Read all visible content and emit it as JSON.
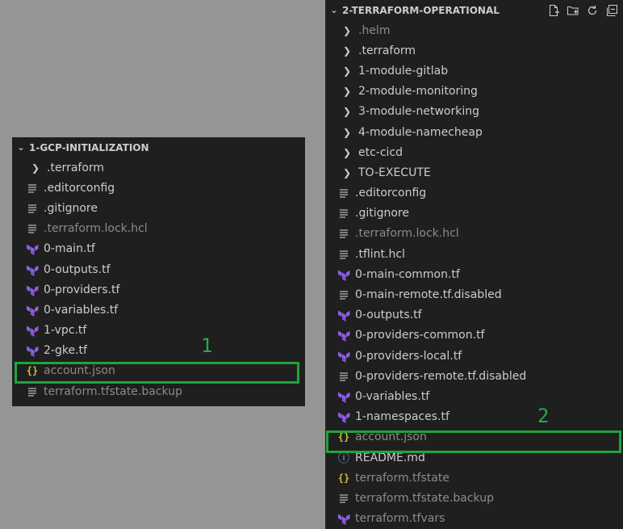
{
  "left_panel": {
    "title": "1-GCP-INITIALIZATION",
    "items": [
      {
        "label": ".terraform",
        "type": "folder",
        "dim": false
      },
      {
        "label": ".editorconfig",
        "type": "file",
        "dim": false
      },
      {
        "label": ".gitignore",
        "type": "file",
        "dim": false
      },
      {
        "label": ".terraform.lock.hcl",
        "type": "file",
        "dim": true
      },
      {
        "label": "0-main.tf",
        "type": "terraform",
        "dim": false
      },
      {
        "label": "0-outputs.tf",
        "type": "terraform",
        "dim": false
      },
      {
        "label": "0-providers.tf",
        "type": "terraform",
        "dim": false
      },
      {
        "label": "0-variables.tf",
        "type": "terraform",
        "dim": false
      },
      {
        "label": "1-vpc.tf",
        "type": "terraform",
        "dim": false
      },
      {
        "label": "2-gke.tf",
        "type": "terraform",
        "dim": false
      },
      {
        "label": "account.json",
        "type": "json",
        "dim": true
      },
      {
        "label": "terraform.tfstate.backup",
        "type": "file",
        "dim": true
      }
    ],
    "annotation": "1"
  },
  "right_panel": {
    "title": "2-TERRAFORM-OPERATIONAL",
    "items": [
      {
        "label": ".helm",
        "type": "folder",
        "dim": true
      },
      {
        "label": ".terraform",
        "type": "folder",
        "dim": false
      },
      {
        "label": "1-module-gitlab",
        "type": "folder",
        "dim": false
      },
      {
        "label": "2-module-monitoring",
        "type": "folder",
        "dim": false
      },
      {
        "label": "3-module-networking",
        "type": "folder",
        "dim": false
      },
      {
        "label": "4-module-namecheap",
        "type": "folder",
        "dim": false
      },
      {
        "label": "etc-cicd",
        "type": "folder",
        "dim": false
      },
      {
        "label": "TO-EXECUTE",
        "type": "folder",
        "dim": false
      },
      {
        "label": ".editorconfig",
        "type": "file",
        "dim": false
      },
      {
        "label": ".gitignore",
        "type": "file",
        "dim": false
      },
      {
        "label": ".terraform.lock.hcl",
        "type": "file",
        "dim": true
      },
      {
        "label": ".tflint.hcl",
        "type": "file",
        "dim": false
      },
      {
        "label": "0-main-common.tf",
        "type": "terraform",
        "dim": false
      },
      {
        "label": "0-main-remote.tf.disabled",
        "type": "file",
        "dim": false
      },
      {
        "label": "0-outputs.tf",
        "type": "terraform",
        "dim": false
      },
      {
        "label": "0-providers-common.tf",
        "type": "terraform",
        "dim": false
      },
      {
        "label": "0-providers-local.tf",
        "type": "terraform",
        "dim": false
      },
      {
        "label": "0-providers-remote.tf.disabled",
        "type": "file",
        "dim": false
      },
      {
        "label": "0-variables.tf",
        "type": "terraform",
        "dim": false
      },
      {
        "label": "1-namespaces.tf",
        "type": "terraform",
        "dim": false
      },
      {
        "label": "account.json",
        "type": "json",
        "dim": true
      },
      {
        "label": "README.md",
        "type": "info",
        "dim": false
      },
      {
        "label": "terraform.tfstate",
        "type": "json",
        "dim": true
      },
      {
        "label": "terraform.tfstate.backup",
        "type": "file",
        "dim": true
      },
      {
        "label": "terraform.tfvars",
        "type": "terraform",
        "dim": true
      }
    ],
    "annotation": "2",
    "action_icons": [
      "new-file-icon",
      "new-folder-icon",
      "refresh-icon",
      "collapse-all-icon"
    ]
  },
  "colors": {
    "panel_bg": "#1f1f1f",
    "page_bg": "#959595",
    "highlight": "#21a33d",
    "terraform_purple": "#8e5de8",
    "json_yellow": "#d7ba3d"
  }
}
